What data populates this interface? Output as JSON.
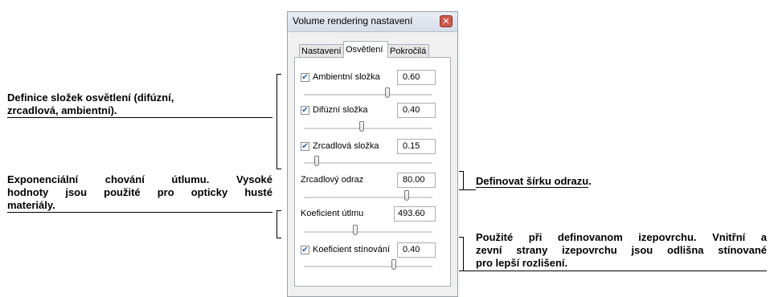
{
  "window": {
    "title": "Volume rendering nastavení",
    "close_glyph": "✕"
  },
  "tabs": [
    {
      "label": "Nastavení",
      "active": false
    },
    {
      "label": "Osvětlení",
      "active": true
    },
    {
      "label": "Pokročilá",
      "active": false
    }
  ],
  "settings": [
    {
      "label": "Ambientní složka",
      "value": "0.60",
      "checked": true,
      "slider_fraction": 0.65
    },
    {
      "label": "Difúzní složka",
      "value": "0.40",
      "checked": true,
      "slider_fraction": 0.45
    },
    {
      "label": "Zrcadlová složka",
      "value": "0.15",
      "checked": true,
      "slider_fraction": 0.1
    },
    {
      "label": "Zrcadlový odraz",
      "value": "80.00",
      "checked": null,
      "slider_fraction": 0.8
    },
    {
      "label": "Koeficient útlmu",
      "value": "493.60",
      "checked": null,
      "slider_fraction": 0.4
    },
    {
      "label": "Koeficient stínování",
      "value": "0.40",
      "checked": true,
      "slider_fraction": 0.7
    }
  ],
  "annotations": {
    "lighting": {
      "line1": "Definice složek osvětlení (difúzní,",
      "line2": "zrcadlová, ambientní)."
    },
    "attenuation": {
      "line1": "Exponenciální chování útlumu. Vysoké",
      "line2": "hodnoty jsou použité pro opticky husté",
      "line3": "materiály."
    },
    "reflection": {
      "text_main": "Definovat šírku odrazu",
      "text_end": "."
    },
    "shading": {
      "line1": "Použité při definovanom izepovrchu. Vnitřní a",
      "line2": "zevní strany izepovrchu jsou odlišna stínované",
      "line3": "pro lepší rozlišení."
    }
  }
}
